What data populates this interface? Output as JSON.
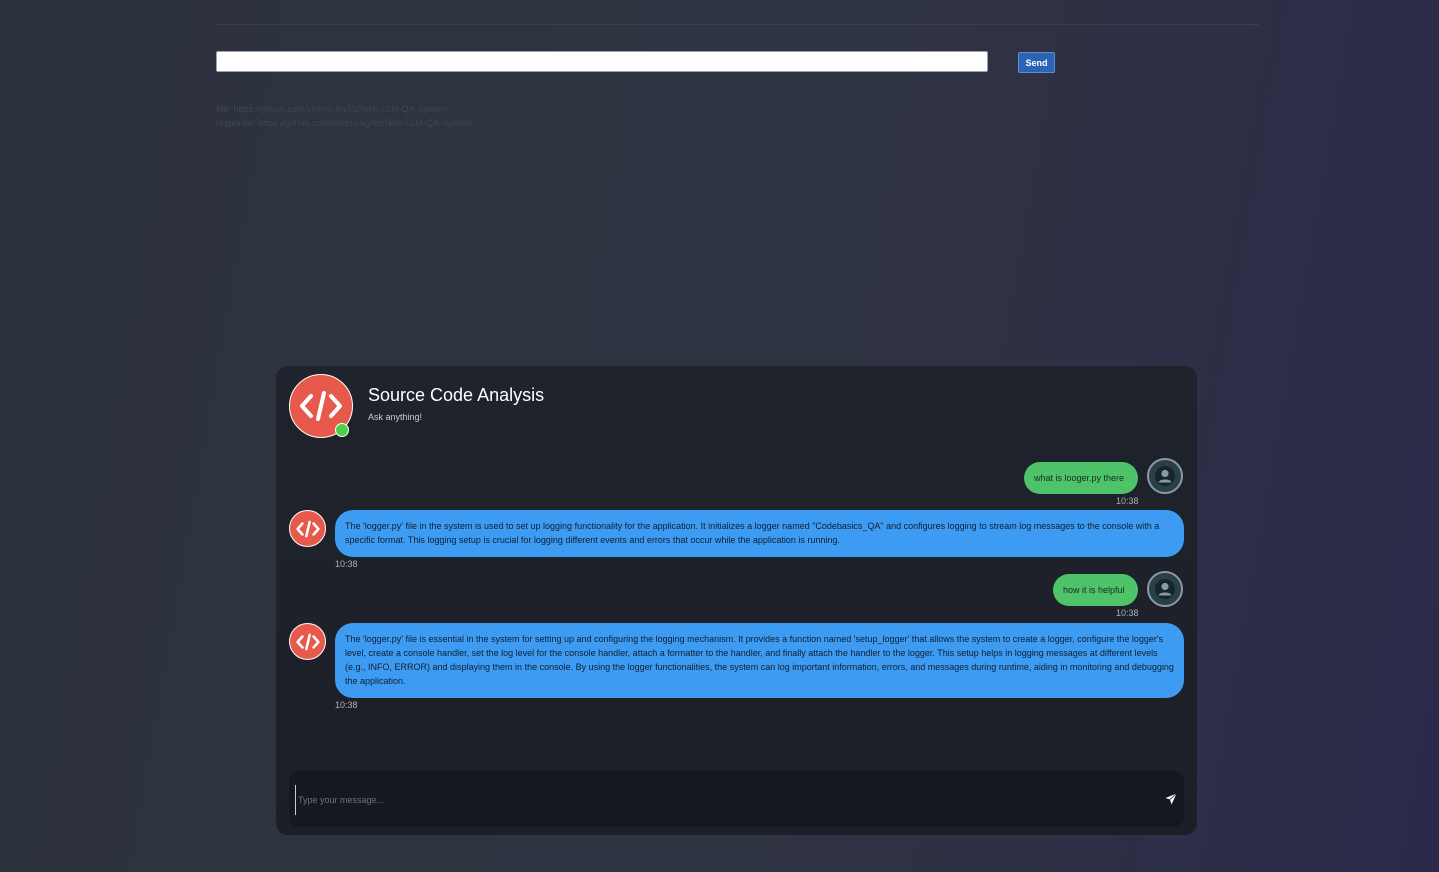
{
  "top_form": {
    "url_value": "",
    "send_label": "Send"
  },
  "log": {
    "line1": "Me: https://github.com/vishnu-kg/EdTech-LLM-QA-System",
    "line2": "response: https://github.com/vishnu-kg/EdTech-LLM-QA-System"
  },
  "chat": {
    "title": "Source Code Analysis",
    "subtitle": "Ask anything!",
    "status": "online",
    "messages": [
      {
        "sender": "user",
        "text": "what is looger.py there",
        "time": "10:38"
      },
      {
        "sender": "bot",
        "text": "The 'logger.py' file in the system is used to set up logging functionality for the application. It initializes a logger named \"Codebasics_QA\" and configures logging to stream log messages to the console with a specific format. This logging setup is crucial for logging different events and errors that occur while the application is running.",
        "time": "10:38"
      },
      {
        "sender": "user",
        "text": "how it is helpful",
        "time": "10:38"
      },
      {
        "sender": "bot",
        "text": "The 'logger.py' file is essential in the system for setting up and configuring the logging mechanism. It provides a function named 'setup_logger' that allows the system to create a logger, configure the logger's level, create a console handler, set the log level for the console handler, attach a formatter to the handler, and finally attach the handler to the logger. This setup helps in logging messages at different levels (e.g., INFO, ERROR) and displaying them in the console. By using the logger functionalities, the system can log important information, errors, and messages during runtime, aiding in monitoring and debugging the application.",
        "time": "10:38"
      }
    ],
    "composer": {
      "placeholder": "Type your message...",
      "value": ""
    }
  },
  "icons": {
    "bot_avatar": "code-brackets-icon",
    "user_avatar": "user-icon",
    "send": "paper-plane-icon"
  },
  "colors": {
    "bot_accent": "#e75a4b",
    "user_bubble": "#4fc36a",
    "bot_bubble": "#3d9cf2",
    "online": "#4cd14c",
    "send_button": "#2a64b3"
  }
}
